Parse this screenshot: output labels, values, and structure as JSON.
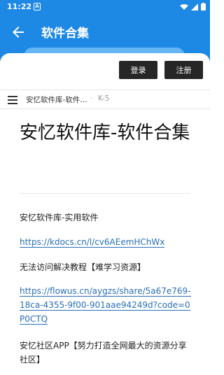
{
  "status": {
    "time": "11:22",
    "notif_letter": "A"
  },
  "appbar": {
    "title": "软件合集"
  },
  "auth": {
    "login_label": "登录",
    "register_label": "注册"
  },
  "doc": {
    "title": "安忆软件库-软件…",
    "separator": "·",
    "code": "K-5",
    "heading": "安忆软件库-软件合集",
    "paragraphs": {
      "p1": "安忆软件库-实用软件",
      "link1": "https://kdocs.cn/l/cv6AEemHChWx",
      "p2": "无法访问解决教程【难学习资源】",
      "link2": "https://flowus.cn/aygzs/share/5a67e769-18ca-4355-9f00-901aae94249d?code=0P0CTQ",
      "p3": "安忆社区APP【努力打造全网最大的资源分享社区】"
    }
  },
  "colors": {
    "primary": "#1e88e5",
    "button_dark": "#262626",
    "link": "#2a6fb8"
  }
}
